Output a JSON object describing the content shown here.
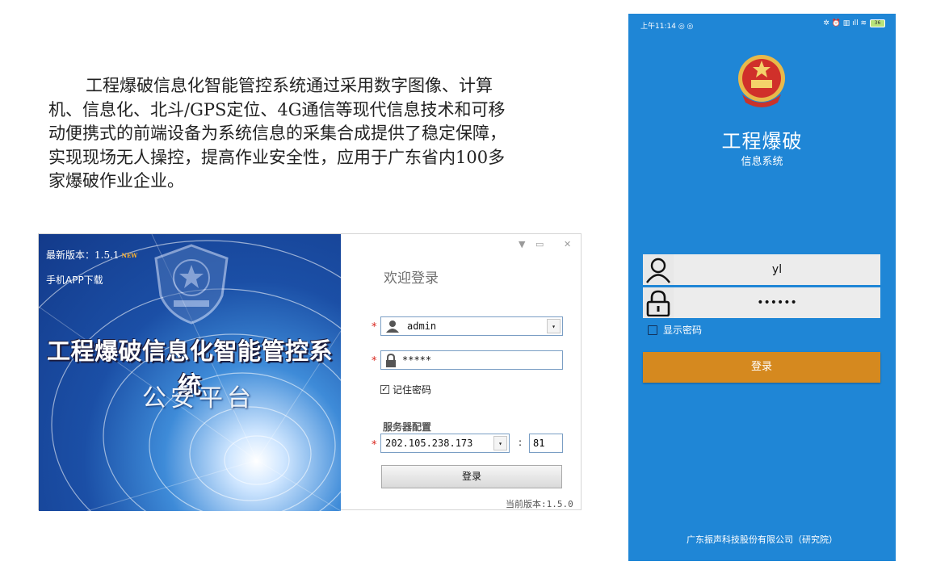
{
  "intro": {
    "text": "工程爆破信息化智能管控系统通过采用数字图像、计算机、信息化、北斗/GPS定位、4G通信等现代信息技术和可移动便携式的前端设备为系统信息的采集合成提供了稳定保障，实现现场无人操控，提高作业安全性，应用于广东省内100多家爆破作业企业。"
  },
  "desktop": {
    "latest_version": "最新版本：1.5.1",
    "new_badge": "NEW",
    "app_download": "手机APP下载",
    "system_title": "工程爆破信息化智能管控系统",
    "system_subtitle": "公安平台",
    "welcome": "欢迎登录",
    "required_mark": "*",
    "username": "admin",
    "password_mask": "*****",
    "remember_label": "记住密码",
    "remember_checked": true,
    "server_label": "服务器配置",
    "server_ip": "202.105.238.173",
    "colon": ":",
    "server_port": "81",
    "login_button": "登录",
    "current_version": "当前版本:1.5.0",
    "dropdown_glyph": "▾",
    "win_controls": {
      "menu": "▼",
      "minimize": "▭",
      "close": "✕"
    }
  },
  "mobile": {
    "status_time": "上午11:14",
    "status_left_icons": "◎ ◎",
    "status_right_icons": "✲ ⏰ ▥ ıll ≋",
    "battery": "36",
    "title": "工程爆破",
    "subtitle": "信息系统",
    "username": "yl",
    "password_mask": "••••••",
    "show_password_label": "显示密码",
    "login_button": "登录",
    "footer": "广东振声科技股份有限公司（研究院）"
  },
  "colors": {
    "phone_bg": "#1f86d6",
    "mobile_login_button": "#d5891f",
    "required_red": "#d9251c",
    "banner_dark": "#133a8a"
  },
  "icons": [
    "police-emblem-icon",
    "user-icon",
    "lock-icon",
    "chevron-down-icon",
    "checkbox-icon",
    "minimize-icon",
    "close-icon",
    "battery-icon",
    "wifi-icon"
  ]
}
